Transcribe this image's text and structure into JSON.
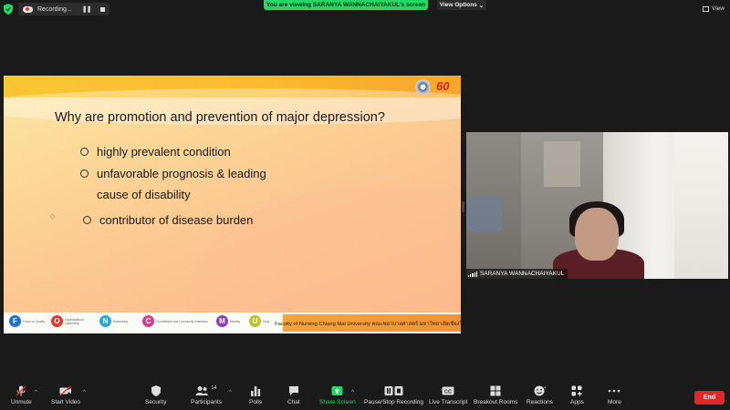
{
  "top_bar": {
    "recording_label": "Recording...",
    "pause_glyph": "❚❚",
    "viewing_banner": "You are viewing SARANYA WANNACHAIYAKUL's screen",
    "view_options_label": "View Options",
    "view_options_caret": "⌄",
    "view_label": "View"
  },
  "slide": {
    "title": "Why are promotion and prevention of major depression?",
    "bullets": [
      "highly prevalent condition",
      "unfavorable prognosis & leading",
      "contributor of disease burden"
    ],
    "bullet_continuation": "cause of disability",
    "logo_b_text": "60",
    "footer_badges": [
      {
        "letter": "F",
        "color": "#1e73c8",
        "text": "Focus on Quality"
      },
      {
        "letter": "O",
        "color": "#e0392f",
        "text": "Organizational Leadership"
      },
      {
        "letter": "N",
        "color": "#2aa6d8",
        "text": "Networking"
      },
      {
        "letter": "C",
        "color": "#d63c8d",
        "text": "Commitment and Community orientation"
      },
      {
        "letter": "M",
        "color": "#8b3fb8",
        "text": "Morality"
      },
      {
        "letter": "U",
        "color": "#b9c42c",
        "text": "Unity"
      }
    ],
    "footer_bar_text": "Faculty of Nursing Chiang Mai University คณะพยาบาลศาสตร์ มหาวิทยาลัยเชียงใหม่"
  },
  "participant": {
    "name": "SARANYA WANNACHAIYAKUL"
  },
  "toolbar": {
    "unmute": "Unmute",
    "start_video": "Start Video",
    "security": "Security",
    "participants": "Participants",
    "participants_count": "14",
    "polls": "Polls",
    "chat": "Chat",
    "share_screen": "Share Screen",
    "pause_stop_recording": "Pause/Stop Recording",
    "live_transcript": "Live Transcript",
    "breakout_rooms": "Breakout Rooms",
    "reactions": "Reactions",
    "apps": "Apps",
    "more": "More",
    "end": "End",
    "caret_glyph": "^"
  },
  "colors": {
    "share_accent": "#23d964",
    "end_red": "#e02828",
    "background": "#1a1a1a"
  }
}
